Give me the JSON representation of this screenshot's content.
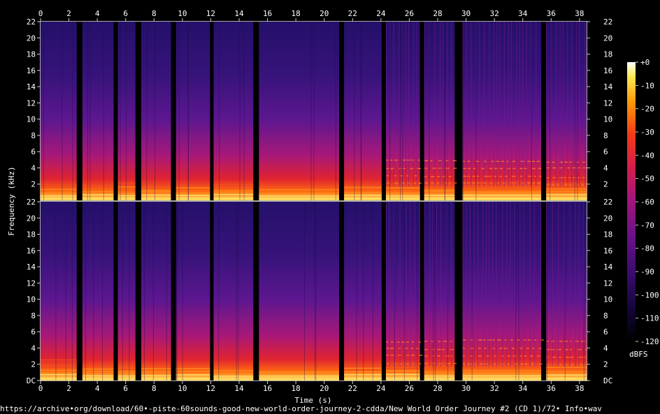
{
  "chart_data": {
    "type": "heatmap",
    "title": "",
    "xlabel": "Time (s)",
    "ylabel": "Frequency (kHz)",
    "xlim": [
      0,
      38.5
    ],
    "x_ticks": [
      0,
      2,
      4,
      6,
      8,
      10,
      12,
      14,
      16,
      18,
      20,
      22,
      24,
      26,
      28,
      30,
      32,
      34,
      36,
      38
    ],
    "channels": [
      {
        "ylim": [
          0,
          22
        ],
        "y_ticks": [
          "2",
          "4",
          "6",
          "8",
          "10",
          "12",
          "14",
          "16",
          "18",
          "20",
          "22"
        ]
      },
      {
        "ylim": [
          0,
          22
        ],
        "y_ticks": [
          "DC",
          "2",
          "4",
          "6",
          "8",
          "10",
          "12",
          "14",
          "16",
          "18",
          "20",
          "22"
        ]
      }
    ],
    "colorbar": {
      "label": "dBFS",
      "range": [
        -120,
        0
      ],
      "ticks": [
        "+0",
        "-10",
        "-20",
        "-30",
        "-40",
        "-50",
        "-60",
        "-70",
        "-80",
        "-90",
        "-100",
        "-110",
        "-120"
      ]
    },
    "silence_gaps_s": [
      [
        2.55,
        2.95
      ],
      [
        5.15,
        5.45
      ],
      [
        6.7,
        7.1
      ],
      [
        9.2,
        9.55
      ],
      [
        11.95,
        12.2
      ],
      [
        15.0,
        15.4
      ],
      [
        21.05,
        21.4
      ],
      [
        24.05,
        24.35
      ],
      [
        26.75,
        27.05
      ],
      [
        29.2,
        29.75
      ],
      [
        35.3,
        35.65
      ]
    ],
    "source": "https://archive•org/download/60•-piste-60sounds-good-new-world-order-journey-2-cdda/New World Order Journey #2 (CD 1)/72• Info•wav"
  }
}
